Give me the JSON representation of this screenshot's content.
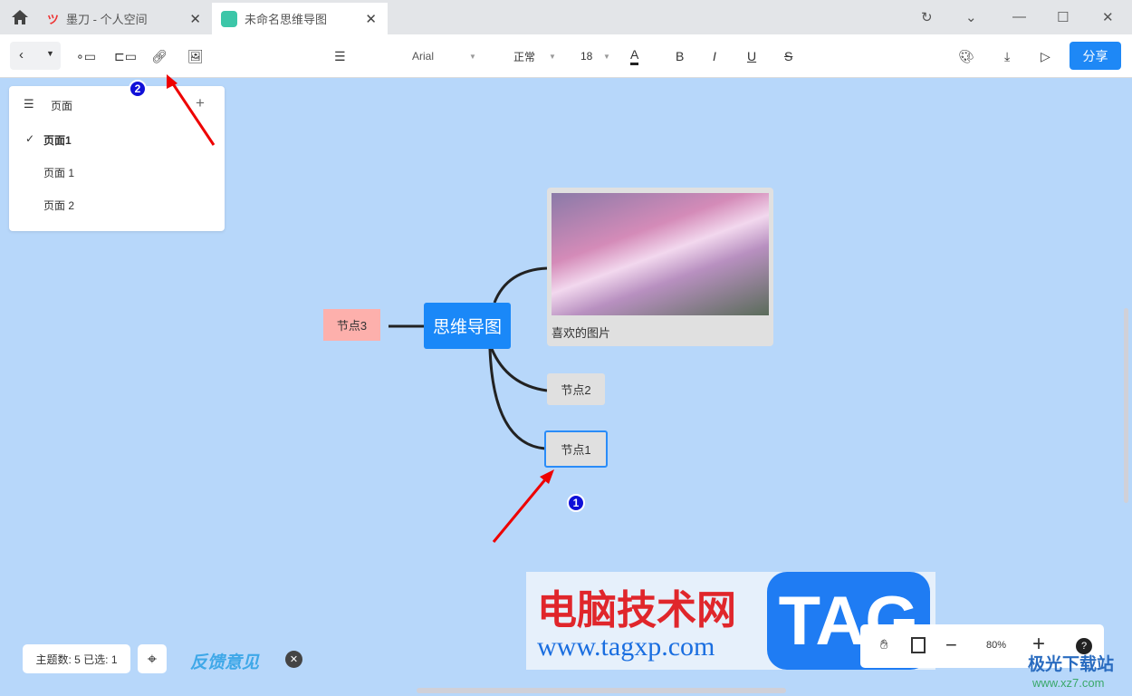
{
  "tabs": [
    {
      "label": "墨刀 - 个人空间"
    },
    {
      "label": "未命名思维导图"
    }
  ],
  "toolbar": {
    "font": "Arial",
    "weight": "正常",
    "size": "18",
    "color_label": "A",
    "bold": "B",
    "italic": "I",
    "underline": "U",
    "strike": "S",
    "share": "分享"
  },
  "pages": {
    "title": "页面",
    "add": "+",
    "items": [
      {
        "label": "页面1",
        "selected": true
      },
      {
        "label": "页面 1"
      },
      {
        "label": "页面 2"
      }
    ]
  },
  "mindmap": {
    "root": "思维导图",
    "node3": "节点3",
    "image_caption": "喜欢的图片",
    "node2": "节点2",
    "node1": "节点1"
  },
  "annotations": {
    "b1": "1",
    "b2": "2"
  },
  "status": {
    "count": "主题数: 5 已选: 1",
    "feedback": "反馈意见",
    "zoom": "80%",
    "help": "?"
  },
  "watermark": {
    "cn": "电脑技术网",
    "url": "www.tagxp.com",
    "tag": "TAG",
    "site": "极光下载站",
    "site_url": "www.xz7.com"
  }
}
